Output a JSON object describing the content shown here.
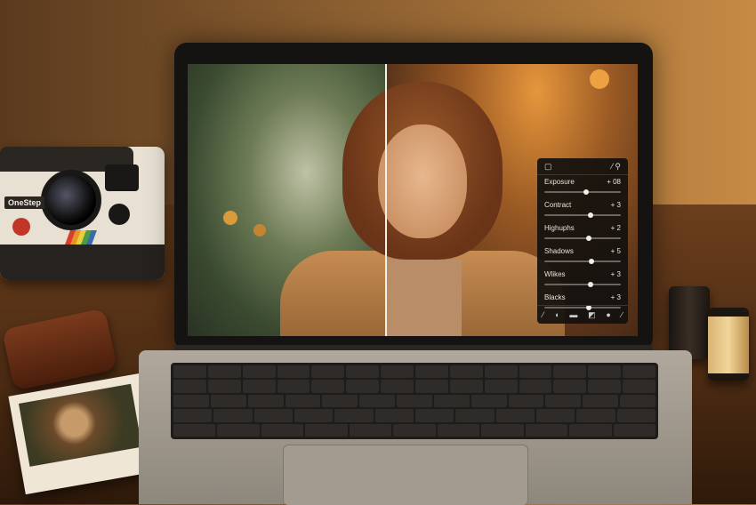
{
  "camera": {
    "brand": "OneStep"
  },
  "panel": {
    "header_icons": [
      "crop-icon",
      "eyedropper-icon",
      "spot-heal-icon"
    ],
    "sliders": [
      {
        "label": "Exposure",
        "value": "+ 08",
        "level": 0.55
      },
      {
        "label": "Contract",
        "value": "+ 3",
        "level": 0.6
      },
      {
        "label": "Highuphs",
        "value": "+ 2",
        "level": 0.58
      },
      {
        "label": "Shadows",
        "value": "+ 5",
        "level": 0.62
      },
      {
        "label": "Wlikes",
        "value": "+ 3",
        "level": 0.6
      },
      {
        "label": "Blacks",
        "value": "+ 3",
        "level": 0.58
      }
    ],
    "tools": [
      "brush-icon",
      "drop-icon",
      "mask-icon",
      "gradient-icon",
      "circle-icon",
      "pen-icon"
    ]
  },
  "colors": {
    "accent_warm": "#c98a3e",
    "panel_bg": "#12100e",
    "split_line": "#f5f0e6"
  }
}
